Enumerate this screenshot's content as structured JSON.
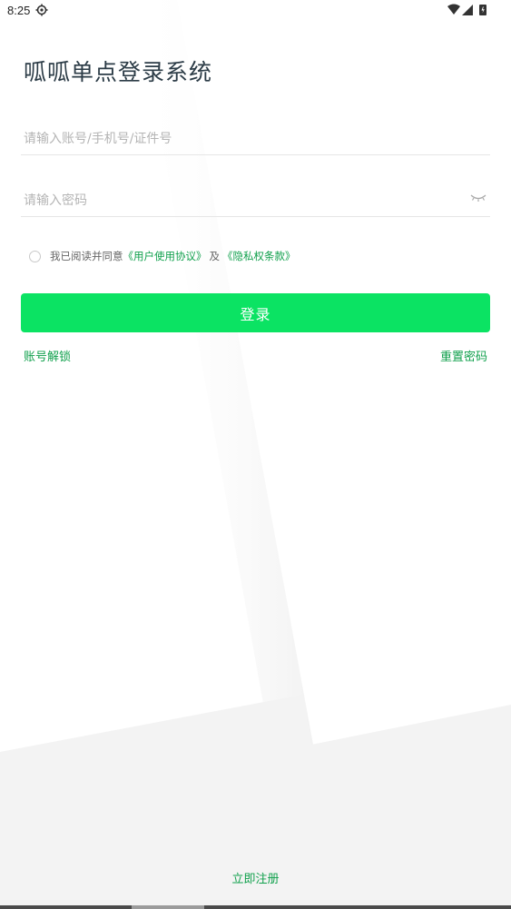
{
  "status_bar": {
    "time": "8:25",
    "icons": [
      "gear-icon",
      "wifi-icon",
      "cell-signal-icon",
      "battery-icon"
    ]
  },
  "login": {
    "title": "呱呱单点登录系统",
    "account_placeholder": "请输入账号/手机号/证件号",
    "account_value": "",
    "password_placeholder": "请输入密码",
    "password_value": "",
    "password_toggle_icon": "eye-closed-icon",
    "agreement": {
      "checked": false,
      "prefix": "我已阅读并同意",
      "user_agreement": "《用户使用协议》",
      "separator": "及",
      "privacy_policy": "《隐私权条款》"
    },
    "login_button": "登录",
    "unlock_account": "账号解锁",
    "reset_password": "重置密码",
    "register": "立即注册"
  },
  "colors": {
    "accent": "#0be363",
    "link": "#10a04c",
    "title": "#2b3b46",
    "placeholder": "#b4b4b4",
    "background": "#ffffff",
    "background_shade": "#f3f3f3"
  }
}
